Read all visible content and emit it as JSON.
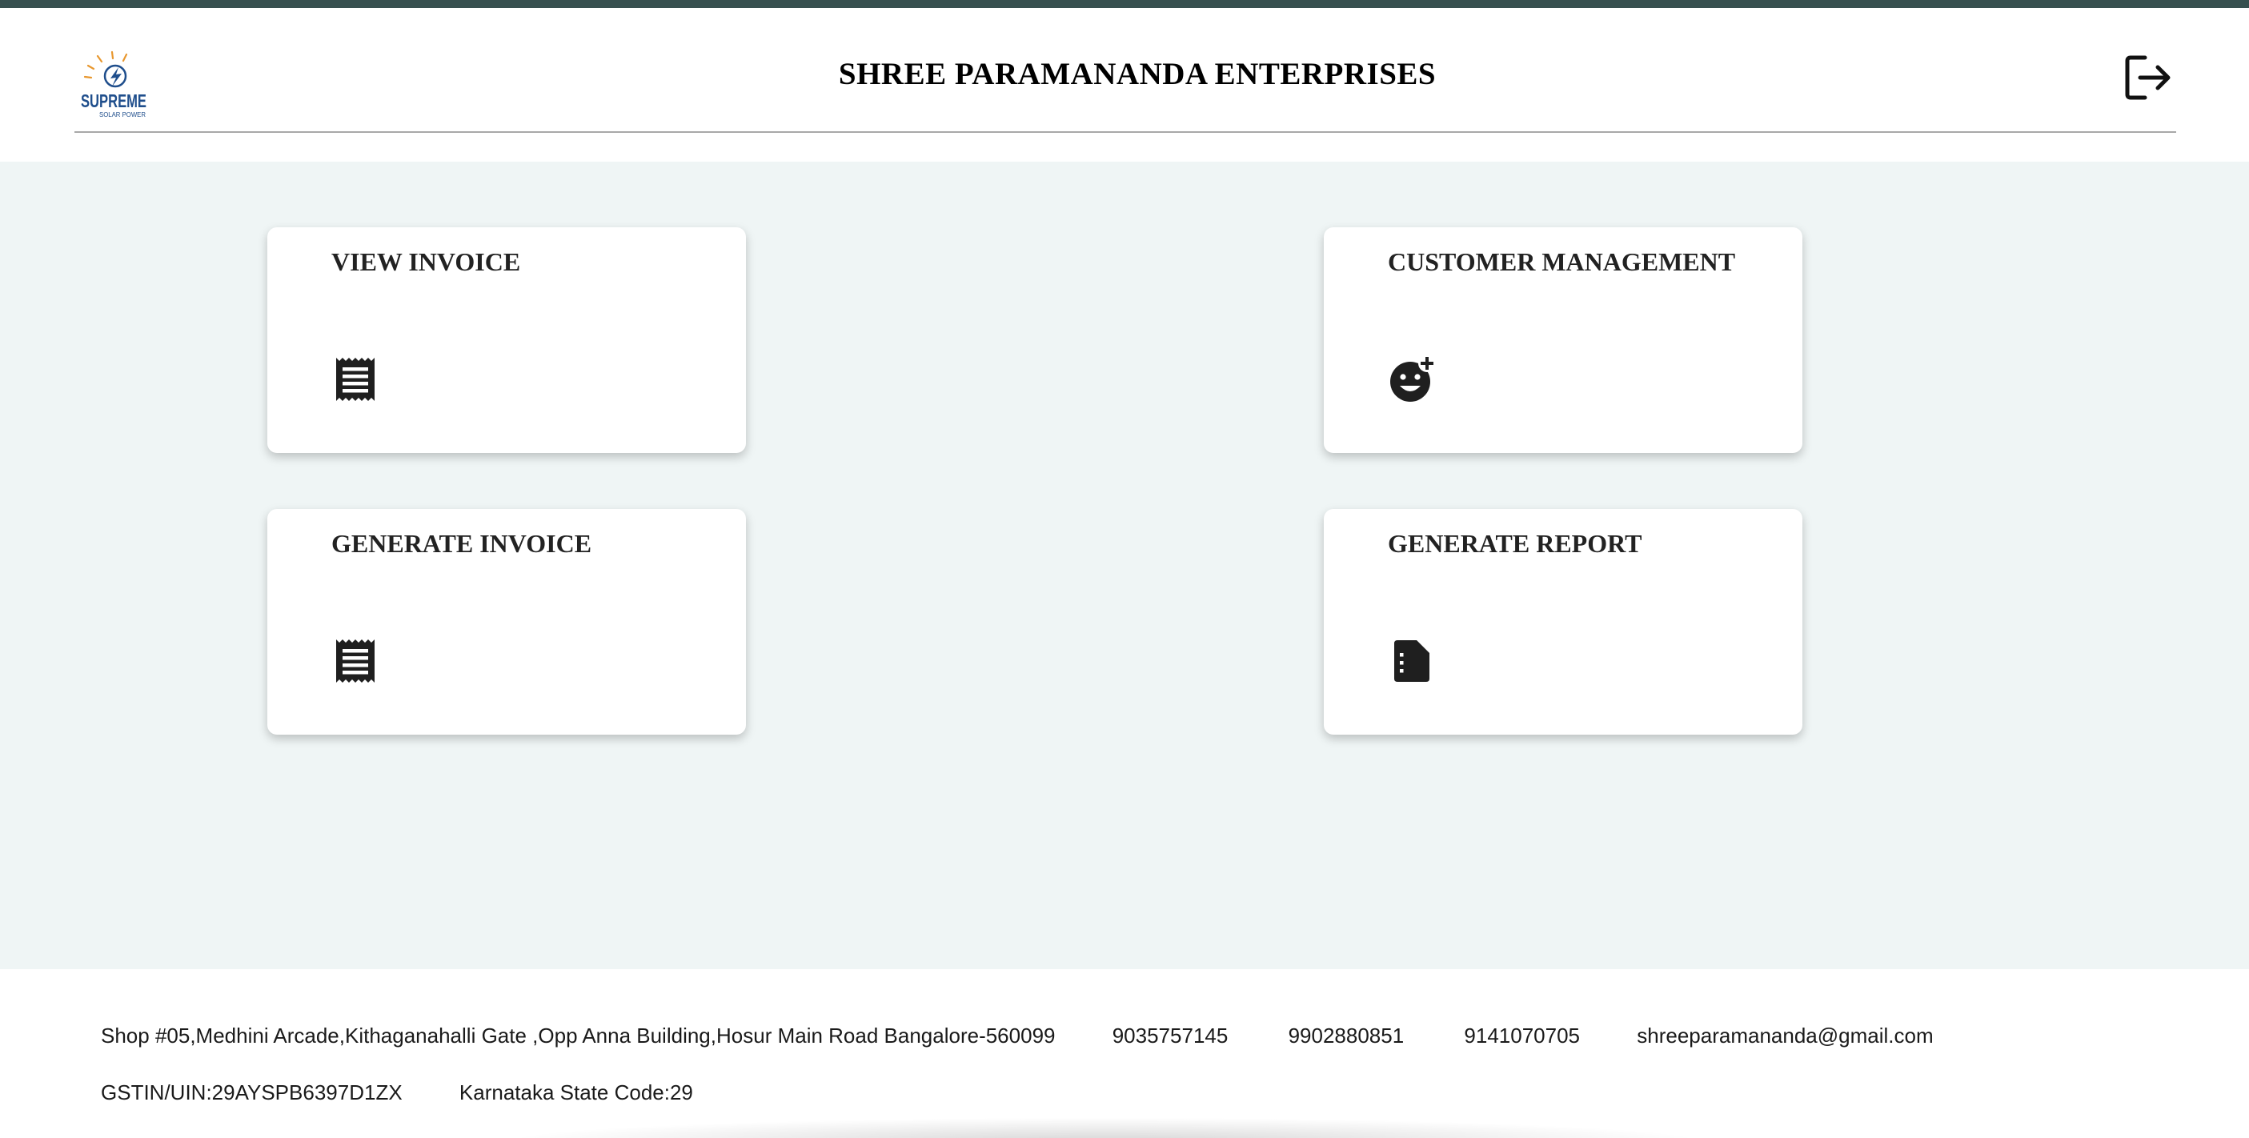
{
  "header": {
    "title": "SHREE PARAMANANDA ENTERPRISES",
    "logo_text": "SUPREME",
    "logo_subtext": "SOLAR POWER",
    "logout_icon": "logout-icon"
  },
  "cards": [
    {
      "title": "VIEW INVOICE",
      "icon": "receipt-icon"
    },
    {
      "title": "CUSTOMER MANAGEMENT",
      "icon": "add-reaction-icon"
    },
    {
      "title": "GENERATE INVOICE",
      "icon": "receipt-icon"
    },
    {
      "title": "GENERATE REPORT",
      "icon": "report-document-icon"
    }
  ],
  "footer": {
    "address": "Shop #05,Medhini Arcade,Kithaganahalli Gate ,Opp Anna Building,Hosur Main Road Bangalore-560099",
    "phones": [
      "9035757145",
      "9902880851",
      "9141070705"
    ],
    "email": "shreeparamananda@gmail.com",
    "gstin": "GSTIN/UIN:29AYSPB6397D1ZX",
    "state_code": "Karnataka State Code:29"
  },
  "colors": {
    "top_strip": "#37504f",
    "content_background": "#eff5f5",
    "card_background": "#ffffff",
    "icon_color": "#1f1f1f"
  }
}
